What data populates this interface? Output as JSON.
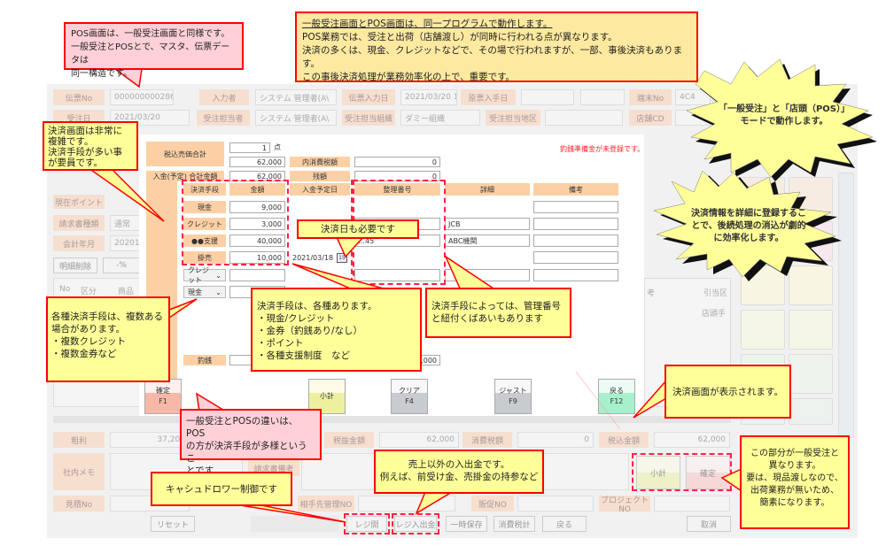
{
  "app": {
    "header": {
      "slip_no_label": "伝票No",
      "slip_no": "000000000286",
      "entered_by_label": "入力者",
      "entered_by": "システム 管理者(A\\",
      "slip_date_label": "伝票入力日",
      "slip_date": "2021/03/20 10",
      "orig_date_label": "原票入手日",
      "terminal_label": "端末No",
      "terminal": "4C4",
      "order_date_label": "受注日",
      "order_date": "2021/03/20",
      "order_staff_label": "受注担当者",
      "order_staff": "システム 管理者(A\\",
      "org_label": "受注担当組織",
      "org": "ダミー組織",
      "area_label": "受注担当地区",
      "store_label": "店舗CD"
    },
    "left": {
      "points_label": "現在ポイント",
      "invoice_type_label": "請求書種類",
      "invoice_type": "通常",
      "fiscal_label": "会計年月",
      "fiscal": "202011",
      "delete_line": "明細削除",
      "percent": "-%",
      "col_no": "No",
      "col_kubun": "区分",
      "col_product": "商品C",
      "col_note": "考",
      "col_alloc": "引当区",
      "store_hand": "店頭手"
    },
    "footer": {
      "gross_label": "粗利",
      "gross": "37,200",
      "excl_label": "税抜金額",
      "excl": "62,000",
      "tax_label": "消費税額",
      "tax": "0",
      "incl_label": "税込金額",
      "incl": "62,000",
      "memo_label": "社内メモ",
      "invoice_note_label": "請求書備考",
      "estimate_label": "見積No",
      "partner_label": "相手先管理NO",
      "promo_label": "販促NO",
      "project_label": "プロジェクトNO",
      "subtotal": "小計",
      "confirm": "確定"
    },
    "buttons": {
      "reset": "リセット",
      "register_open": "レジ開",
      "register_cash": "レジ入出金",
      "temp_save": "一時保存",
      "tax_total": "消費税計",
      "back": "戻る",
      "cancel": "取消"
    }
  },
  "dialog": {
    "warning": "釣銭準備金が未登録です。",
    "total_label": "税込売価合計",
    "qty": "1",
    "qty_unit": "点",
    "total": "62,000",
    "inner_tax_label": "内消費税額",
    "inner_tax": "0",
    "paid_label": "入金(予定) 合計金額",
    "paid": "62,000",
    "remain_label": "残額",
    "remain": "0",
    "cols": [
      "決済手段",
      "金額",
      "入金予定日",
      "整理番号",
      "詳細",
      "備考"
    ],
    "rows": [
      {
        "method": "現金",
        "amount": "9,000",
        "date": "",
        "ref": "",
        "detail": ""
      },
      {
        "method": "クレジット",
        "amount": "3,000",
        "date": "",
        "ref": "",
        "detail": "JCB"
      },
      {
        "method": "●●支援",
        "amount": "40,000",
        "date": "",
        "ref": "…45",
        "detail": "ABC機関"
      },
      {
        "method": "掛売",
        "amount": "10,000",
        "date": "2021/03/18",
        "ref": "",
        "detail": ""
      }
    ],
    "select_rows": [
      "クレジット",
      "現金"
    ],
    "change_label": "釣銭",
    "received": "9,000",
    "calendar_icon": "15",
    "keys": [
      {
        "label": "確定",
        "key": "F1"
      },
      {
        "label": "小計",
        "key": ""
      },
      {
        "label": "クリア",
        "key": "F4"
      },
      {
        "label": "ジャスト",
        "key": "F9"
      },
      {
        "label": "戻る",
        "key": "F12"
      }
    ]
  },
  "callouts": {
    "pos_same": [
      "POS画面は、一般受注画面と同様です。",
      "一般受注とPOSとで、マスタ、伝票データは",
      "同一構造です。"
    ],
    "same_program": {
      "title": "一般受注画面とPOS画面は、同一プログラムで動作します。",
      "lines": [
        "POS業務では、受注と出荷（店舗渡し）が同時に行われる点が異なります。",
        "決済の多くは、現金、クレジットなどで、その場で行われますが、一部、事後決済もあります。",
        "この事後決済処理が業務効率化の上で、重要です。"
      ]
    },
    "modes": [
      "「一般受注」と「店頭（POS）」",
      "モードで動作します。"
    ],
    "detail_reg": [
      "決済情報を詳細に登録するこ",
      "とで、後続処理の消込が劇的",
      "に効率化します。"
    ],
    "complex": [
      "決済画面は非常に",
      "複雑です。",
      "決済手段が多い事",
      "が要員です。"
    ],
    "date_needed": "決済日も必要です",
    "multiple": [
      "各種決済手段は、複数ある",
      "場合があります。",
      "・複数クレジット",
      "・複数金券など"
    ],
    "methods": [
      "決済手段は、各種あります。",
      "・現金/クレジット",
      "・金券（釣銭あり/なし）",
      "・ポイント",
      "・各種支援制度　など"
    ],
    "mgmt_no": [
      "決済手段によっては、管理番号",
      "と紐付くばあいもあります"
    ],
    "diff": [
      "一般受注とPOSの違いは、POS",
      "の方が決済手段が多様というこ",
      "とです。"
    ],
    "shown": "決済画面が表示されます。",
    "this_part": [
      "この部分が一般受注と",
      "異なります。",
      "要は、現品渡しなので、",
      "出荷業務が無いため、",
      "簡素になります。"
    ],
    "drawer": "キャシュドロワー制御です",
    "cash_io": [
      "売上以外の入出金です。",
      "例えば、前受け金、売掛金の持参など"
    ]
  }
}
